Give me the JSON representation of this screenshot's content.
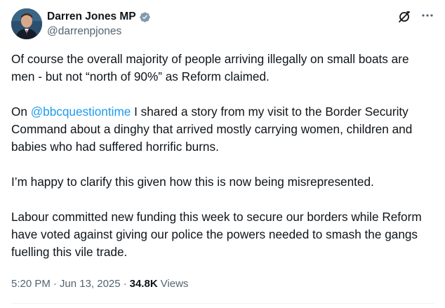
{
  "author": {
    "display_name": "Darren Jones MP",
    "handle": "@darrenpjones",
    "verified_color": "#829aab"
  },
  "actions": {
    "grok_icon": "grok-icon",
    "more_icon": "more-horizontal-icon"
  },
  "post": {
    "p1": "Of course the overall majority of people arriving illegally on small boats are men - but not “north of 90%” as Reform claimed.",
    "p2_prefix": "On ",
    "p2_mention": "@bbcquestiontime",
    "p2_suffix": " I shared a story from my visit to the Border Security Command about a dinghy that arrived mostly carrying women, children and babies who had suffered horrific burns.",
    "p3": "I’m happy to clarify this given how this is now being misrepresented.",
    "p4": "Labour committed new funding this week to secure our borders while Reform have voted against giving our police the powers needed to smash the gangs fuelling this vile trade."
  },
  "meta": {
    "time": "5:20 PM",
    "dot1": "·",
    "date": "Jun 13, 2025",
    "dot2": "·",
    "views_count": "34.8K",
    "views_label": "Views"
  },
  "colors": {
    "link": "#1d9bf0",
    "secondary_text": "#536471",
    "primary_text": "#0f1419"
  }
}
